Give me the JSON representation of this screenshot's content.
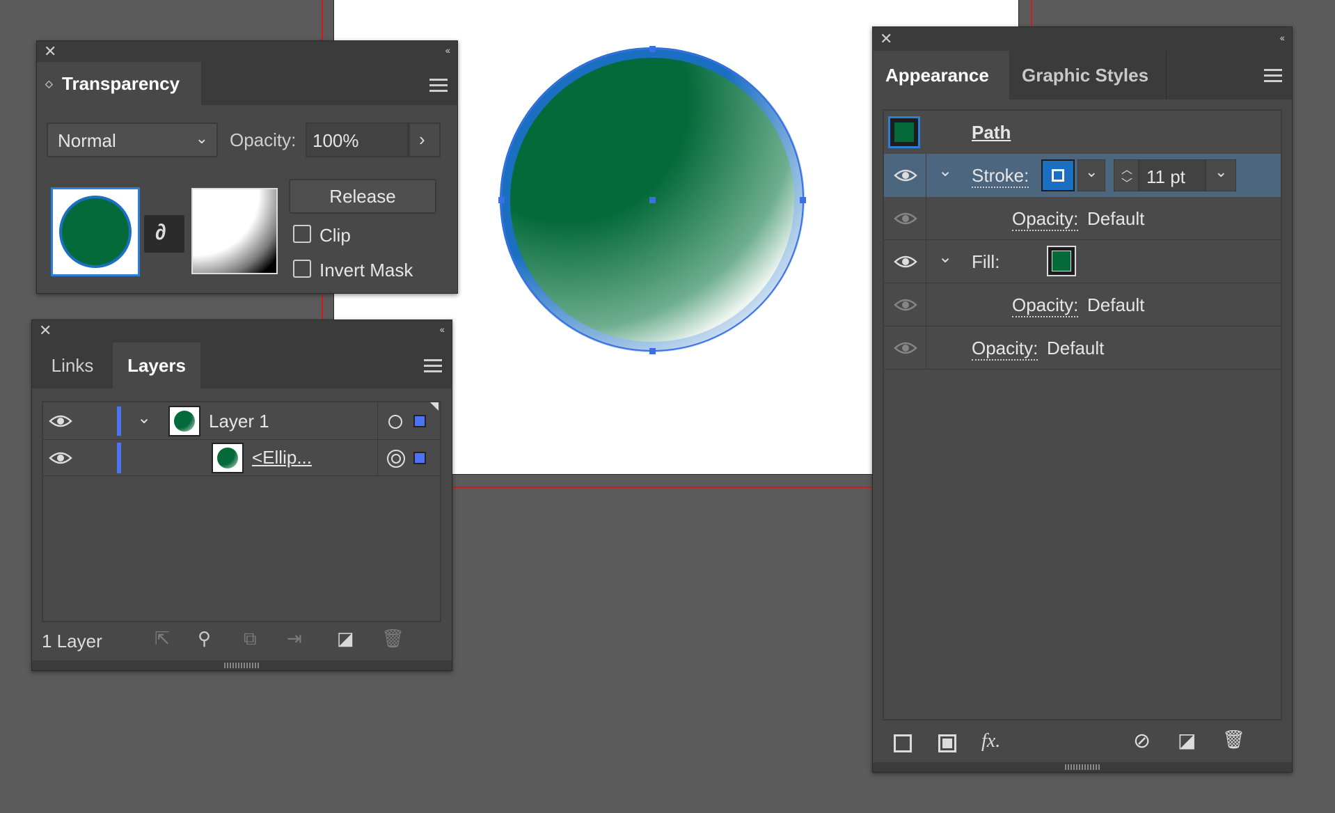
{
  "transparency": {
    "title": "Transparency",
    "blend_mode": "Normal",
    "opacity_label": "Opacity:",
    "opacity_value": "100%",
    "release_label": "Release",
    "clip_label": "Clip",
    "invert_mask_label": "Invert Mask"
  },
  "layers_panel": {
    "tabs": [
      "Links",
      "Layers"
    ],
    "rows": [
      {
        "name": "Layer 1"
      },
      {
        "name": "<Ellip..."
      }
    ],
    "footer_count": "1 Layer"
  },
  "appearance": {
    "tabs": [
      "Appearance",
      "Graphic Styles"
    ],
    "path_label": "Path",
    "stroke_label": "Stroke:",
    "stroke_weight": "11 pt",
    "fill_label": "Fill:",
    "opacity_label": "Opacity:",
    "opacity_default": "Default"
  },
  "colors": {
    "fill_green": "#046a3a",
    "stroke_blue": "#1a6fc0",
    "selection_blue": "#3a6fe8",
    "panel_bg": "#484848",
    "tab_bar_bg": "#3b3b3b",
    "canvas_bg": "#5b5b5b",
    "guide_red": "#d21b1b"
  }
}
